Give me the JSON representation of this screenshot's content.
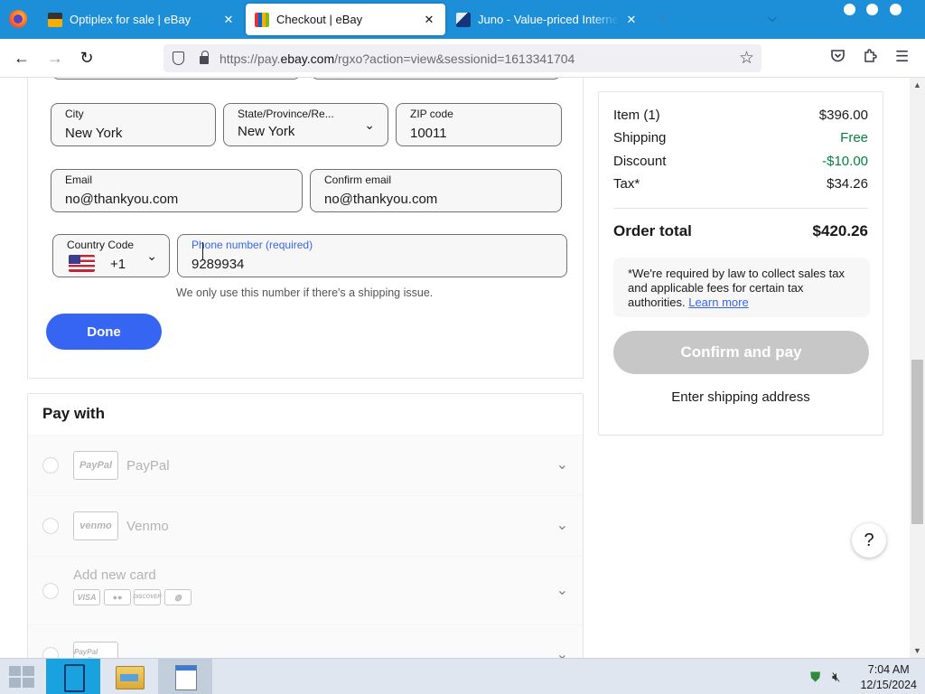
{
  "browser": {
    "tabs": [
      {
        "title": "Optiplex for sale | eBay",
        "close": "✕",
        "active": false
      },
      {
        "title": "Checkout | eBay",
        "close": "✕",
        "active": true
      },
      {
        "title": "Juno - Value-priced Internet Se",
        "close": "✕",
        "active": false
      }
    ],
    "new_tab": "+",
    "tab_list": "⌵",
    "url_host_prefix": "https://pay.",
    "url_host": "ebay.com",
    "url_path": "/rgxo?action=view&sessionid=1613341704",
    "icons": {
      "back": "←",
      "forward": "→",
      "reload": "↻",
      "star": "☆",
      "pocket": "pocket-icon",
      "extensions": "puzzle-icon",
      "menu": "☰"
    }
  },
  "address_form": {
    "city": {
      "label": "City",
      "value": "New York"
    },
    "state": {
      "label": "State/Province/Re...",
      "value": "New York"
    },
    "zip": {
      "label": "ZIP code",
      "value": "10011"
    },
    "email": {
      "label": "Email",
      "value": "no@thankyou.com"
    },
    "confirm_email": {
      "label": "Confirm email",
      "value": "no@thankyou.com"
    },
    "country_code": {
      "label": "Country Code",
      "value": "+1"
    },
    "phone": {
      "label": "Phone number (required)",
      "value": "9289934"
    },
    "phone_helper": "We only use this number if there's a shipping issue.",
    "done_label": "Done"
  },
  "pay_with": {
    "title": "Pay with",
    "options": [
      {
        "logo": "PayPal",
        "name": "PayPal"
      },
      {
        "logo": "venmo",
        "name": "Venmo"
      },
      {
        "name": "Add new card",
        "cards": [
          "VISA",
          "mastercard",
          "DISCOVER",
          "diners"
        ]
      },
      {
        "logo": "PayPal credit"
      }
    ]
  },
  "summary": {
    "item_label": "Item (1)",
    "item_amount": "$396.00",
    "shipping_label": "Shipping",
    "shipping_amount": "Free",
    "discount_label": "Discount",
    "discount_amount": "-$10.00",
    "tax_label": "Tax*",
    "tax_amount": "$34.26",
    "total_label": "Order total",
    "total_amount": "$420.26",
    "tax_note": "*We're required by law to collect sales tax and applicable fees for certain tax authorities.",
    "learn_more": "Learn more",
    "confirm_label": "Confirm and pay",
    "shipping_hint": "Enter shipping address",
    "help": "?",
    "colors": {
      "accent": "#3665f3",
      "green": "#05823f",
      "disabled": "#c7c7c7"
    }
  },
  "taskbar": {
    "time": "7:04 AM",
    "date": "12/15/2024"
  }
}
